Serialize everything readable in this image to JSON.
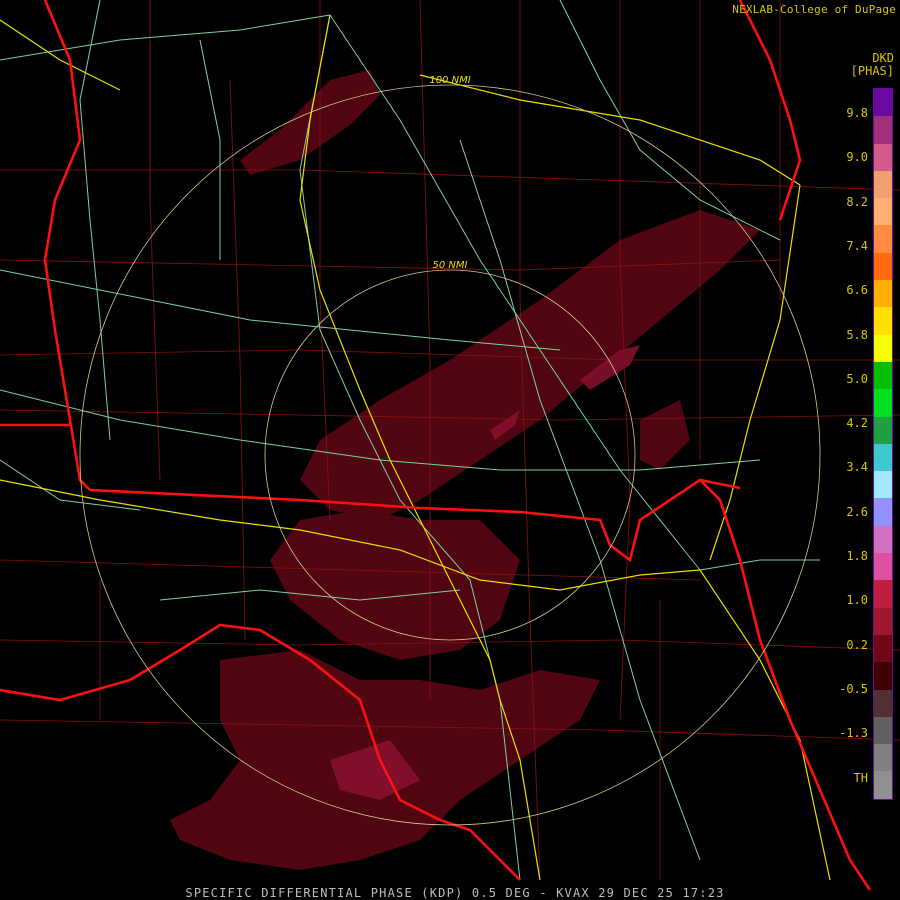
{
  "header": {
    "credit": "NEXLAB-College of DuPage",
    "product_code": "DKD",
    "product_unit": "[PHAS]"
  },
  "legend": {
    "labels": [
      "9.8",
      "9.0",
      "8.2",
      "7.4",
      "6.6",
      "5.8",
      "5.0",
      "4.2",
      "3.4",
      "2.6",
      "1.8",
      "1.0",
      "0.2",
      "-0.5",
      "-1.3",
      "TH"
    ],
    "colors": [
      "#6a0aa0",
      "#a0307a",
      "#d45a8a",
      "#f0a070",
      "#ffb070",
      "#ff8a40",
      "#ff6a10",
      "#ffb000",
      "#ffe000",
      "#f4ff00",
      "#00c000",
      "#00e020",
      "#20a040",
      "#40c8d0",
      "#a0e8ff",
      "#9090ff",
      "#d070c0",
      "#e050a0",
      "#c02040",
      "#a01830",
      "#700818",
      "#400008",
      "#503030",
      "#606060",
      "#808080",
      "#909090"
    ]
  },
  "range_rings": {
    "inner_label": "50 NMI",
    "outer_label": "100 NMI"
  },
  "footer": {
    "title": "SPECIFIC DIFFERENTIAL PHASE (KDP) 0.5 DEG - KVAX 29 DEC 25 17:23"
  }
}
